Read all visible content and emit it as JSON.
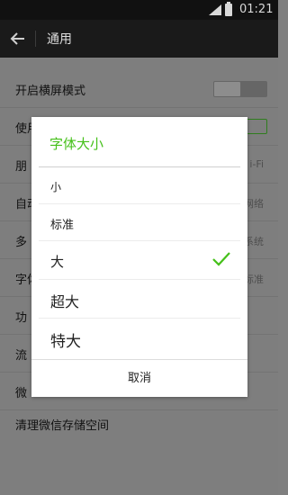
{
  "status_bar": {
    "time": "01:21"
  },
  "header": {
    "title": "通用"
  },
  "settings": [
    {
      "label": "开启横屏模式",
      "value": ""
    },
    {
      "label": "使用",
      "value": ""
    },
    {
      "label": "朋",
      "value": "i-Fi"
    },
    {
      "label": "自动",
      "value": "网络"
    },
    {
      "label": "多",
      "value": "系统"
    },
    {
      "label": "字体",
      "value": "标准"
    },
    {
      "label": "功",
      "value": ""
    },
    {
      "label": "流",
      "value": ""
    },
    {
      "label": "微",
      "value": ""
    },
    {
      "label": "清理微信存储空间",
      "value": ""
    }
  ],
  "dialog": {
    "title": "字体大小",
    "options": [
      {
        "label": "小",
        "selected": false
      },
      {
        "label": "标准",
        "selected": false
      },
      {
        "label": "大",
        "selected": true
      },
      {
        "label": "超大",
        "selected": false
      },
      {
        "label": "特大",
        "selected": false
      }
    ],
    "cancel_label": "取消"
  },
  "colors": {
    "accent": "#45c01a",
    "overlay": "#7f7f7f",
    "title_bar": "#1a1a1a"
  }
}
